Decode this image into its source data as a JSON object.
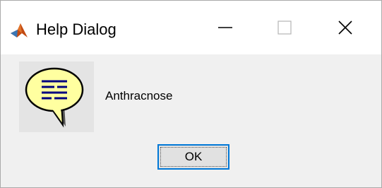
{
  "window": {
    "title": "Help Dialog",
    "app_icon": "matlab-icon",
    "controls": {
      "minimize_icon": "minimize-icon",
      "maximize_icon": "maximize-icon",
      "close_icon": "close-icon"
    }
  },
  "dialog": {
    "icon": "help-speech-bubble-icon",
    "message": "Anthracnose",
    "ok_label": "OK"
  },
  "colors": {
    "titlebar_bg": "#ffffff",
    "body_bg": "#f0f0f0",
    "button_bg": "#e1e1e1",
    "button_focus_border": "#0078d7",
    "help_bubble_fill": "#ffffa0",
    "help_lines": "#000080"
  }
}
